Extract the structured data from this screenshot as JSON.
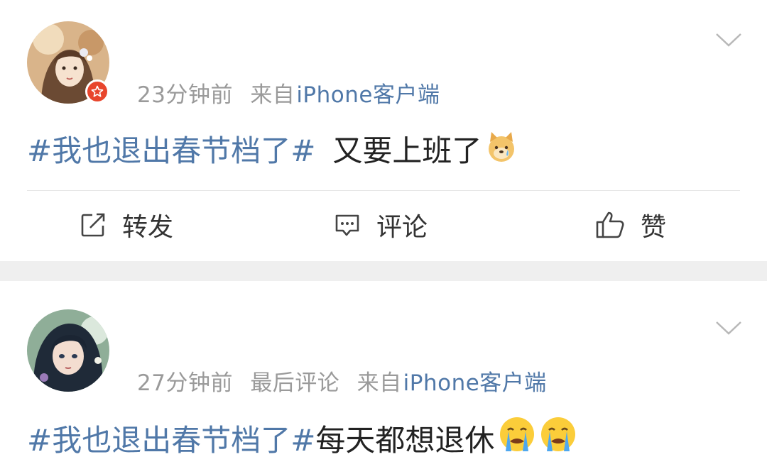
{
  "posts": [
    {
      "time": "23分钟前",
      "source_prefix": "来自",
      "source": "iPhone客户端",
      "topic": "#我也退出春节档了#",
      "text": "又要上班了",
      "emoji": [
        "crying-dog-emoji"
      ]
    },
    {
      "time": "27分钟前",
      "extra": "最后评论",
      "source_prefix": "来自",
      "source": "iPhone客户端",
      "topic": "#我也退出春节档了#",
      "text": "每天都想退休",
      "emoji": [
        "crying-face-emoji",
        "crying-face-emoji"
      ]
    }
  ],
  "actions": {
    "repost": "转发",
    "comment": "评论",
    "like": "赞"
  },
  "colors": {
    "link": "#5078a8",
    "badge": "#e8452c",
    "meta": "#9a9a9a"
  }
}
